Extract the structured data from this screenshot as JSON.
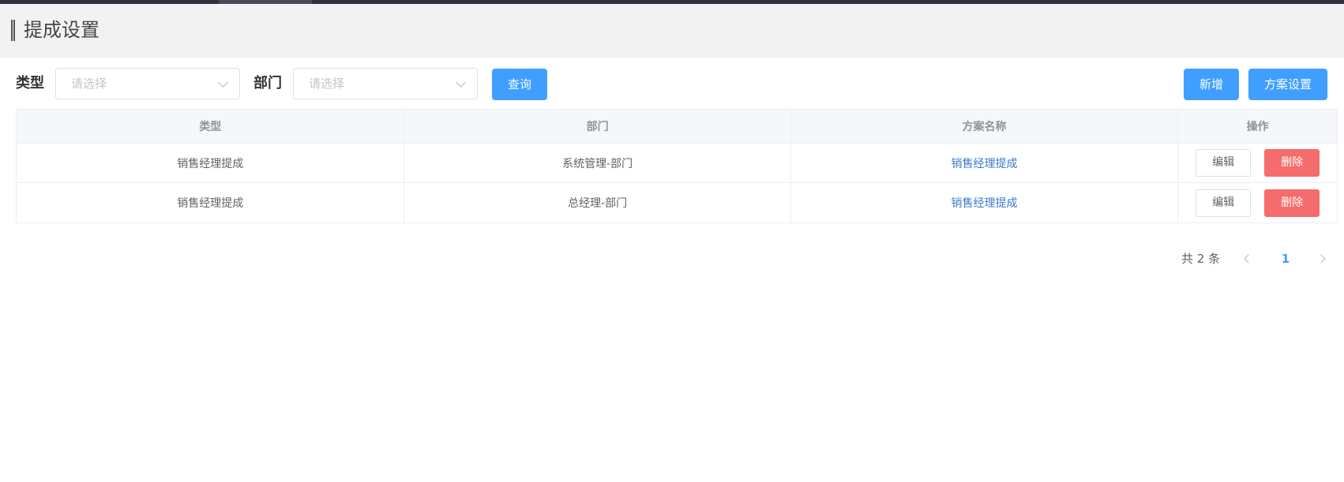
{
  "header": {
    "title": "提成设置"
  },
  "filters": {
    "type_label": "类型",
    "type_placeholder": "请选择",
    "dept_label": "部门",
    "dept_placeholder": "请选择"
  },
  "toolbar": {
    "query_label": "查询",
    "add_label": "新增",
    "scheme_label": "方案设置"
  },
  "table": {
    "columns": [
      "类型",
      "部门",
      "方案名称",
      "操作"
    ],
    "rows": [
      {
        "type": "销售经理提成",
        "dept": "系统管理-部门",
        "scheme": "销售经理提成",
        "edit": "编辑",
        "delete": "删除"
      },
      {
        "type": "销售经理提成",
        "dept": "总经理-部门",
        "scheme": "销售经理提成",
        "edit": "编辑",
        "delete": "删除"
      }
    ]
  },
  "pagination": {
    "total_text": "共 2 条",
    "current_page": "1"
  },
  "colors": {
    "primary": "#409eff",
    "danger": "#f56c6c",
    "link": "#3a7bc8"
  }
}
